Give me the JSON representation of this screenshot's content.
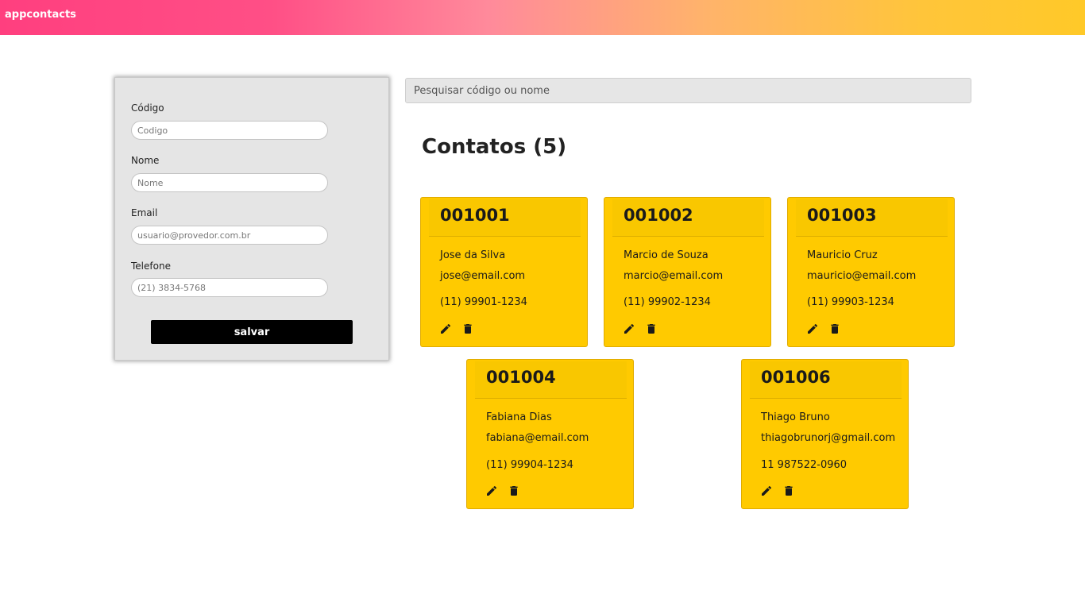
{
  "app": {
    "brand": "appcontacts"
  },
  "form": {
    "fields": [
      {
        "label": "Código",
        "placeholder": "Codigo",
        "value": ""
      },
      {
        "label": "Nome",
        "placeholder": "Nome",
        "value": ""
      },
      {
        "label": "Email",
        "placeholder": "usuario@provedor.com.br",
        "value": ""
      },
      {
        "label": "Telefone",
        "placeholder": "(21) 3834-5768",
        "value": ""
      }
    ],
    "save_label": "salvar"
  },
  "search": {
    "placeholder": "Pesquisar código ou nome",
    "value": ""
  },
  "contacts": {
    "title": "Contatos (5)",
    "items": [
      {
        "code": "001001",
        "name": "Jose da Silva",
        "email": "jose@email.com",
        "phone": "(11) 99901-1234"
      },
      {
        "code": "001002",
        "name": "Marcio de Souza",
        "email": "marcio@email.com",
        "phone": "(11) 99902-1234"
      },
      {
        "code": "001003",
        "name": "Mauricio Cruz",
        "email": "mauricio@email.com",
        "phone": "(11) 99903-1234"
      },
      {
        "code": "001004",
        "name": "Fabiana Dias",
        "email": "fabiana@email.com",
        "phone": "(11) 99904-1234"
      },
      {
        "code": "001006",
        "name": "Thiago Bruno",
        "email": "thiagobrunorj@gmail.com",
        "phone": "11 987522-0960"
      }
    ],
    "actions": {
      "edit_icon": "pencil-icon",
      "delete_icon": "trash-icon"
    }
  },
  "colors": {
    "card_bg": "#ffca00",
    "save_button_bg": "#000000",
    "form_panel_bg": "#e5e5e5",
    "header_gradient_start": "#ff3f7f",
    "header_gradient_end": "#ffc928"
  }
}
